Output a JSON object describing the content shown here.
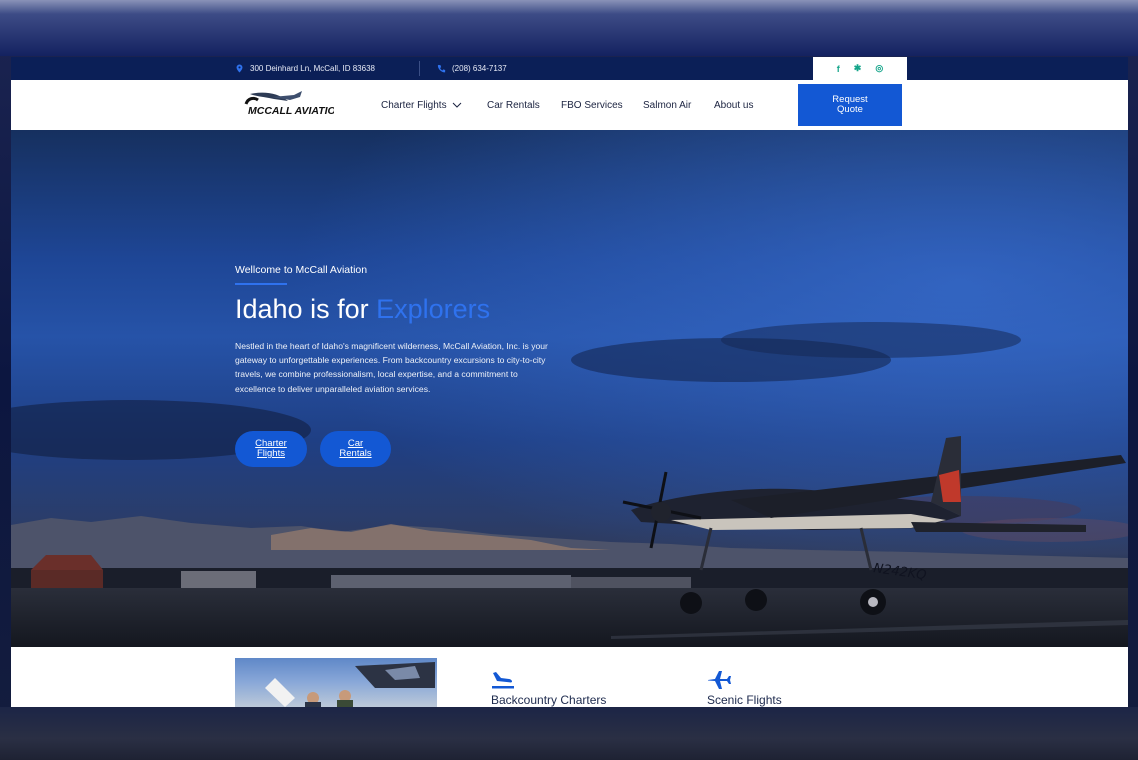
{
  "topbar": {
    "address": "300 Deinhard Ln, McCall, ID 83638",
    "phone": "(208) 634-7137",
    "social": [
      "facebook-icon",
      "yelp-icon",
      "instagram-icon"
    ]
  },
  "nav": {
    "logo_text": "MCCALL AVIATION",
    "items": [
      "Charter Flights",
      "Car Rentals",
      "FBO Services",
      "Salmon Air",
      "About us"
    ],
    "cta": "Request\nQuote"
  },
  "hero": {
    "eyebrow": "Wellcome to McCall Aviation",
    "headline_plain": "Idaho is for ",
    "headline_accent": "Explorers",
    "blurb": "Nestled in the heart of Idaho's magnificent wilderness, McCall Aviation, Inc. is your gateway to unforgettable experiences. From backcountry excursions to city-to-city travels, we combine professionalism, local expertise, and a commitment to excellence to deliver unparalleled aviation services.",
    "buttons": [
      "Charter\nFlights",
      "Car\nRentals"
    ],
    "plane_tail": "N242KQ"
  },
  "features": {
    "items": [
      {
        "icon": "plane-landing-icon",
        "label": "Backcountry Charters"
      },
      {
        "icon": "airplane-icon",
        "label": "Scenic Flights"
      }
    ]
  },
  "colors": {
    "accent": "#1358d4",
    "headline_accent": "#2f72ee",
    "topbar": "#0b1f57",
    "social": "#15a58a"
  }
}
